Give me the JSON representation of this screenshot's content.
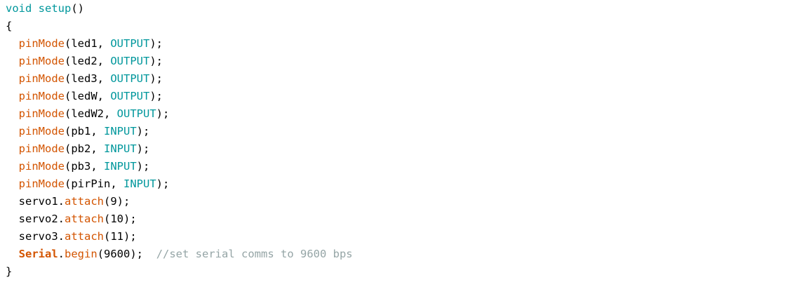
{
  "editor": {
    "lines": [
      [
        {
          "t": "void",
          "c": "kw"
        },
        {
          "t": " ",
          "c": ""
        },
        {
          "t": "setup",
          "c": "kw"
        },
        {
          "t": "()",
          "c": ""
        }
      ],
      [
        {
          "t": "{",
          "c": ""
        }
      ],
      [
        {
          "t": "  ",
          "c": ""
        },
        {
          "t": "pinMode",
          "c": "fn"
        },
        {
          "t": "(led1, ",
          "c": ""
        },
        {
          "t": "OUTPUT",
          "c": "const"
        },
        {
          "t": ");",
          "c": ""
        }
      ],
      [
        {
          "t": "  ",
          "c": ""
        },
        {
          "t": "pinMode",
          "c": "fn"
        },
        {
          "t": "(led2, ",
          "c": ""
        },
        {
          "t": "OUTPUT",
          "c": "const"
        },
        {
          "t": ");",
          "c": ""
        }
      ],
      [
        {
          "t": "  ",
          "c": ""
        },
        {
          "t": "pinMode",
          "c": "fn"
        },
        {
          "t": "(led3, ",
          "c": ""
        },
        {
          "t": "OUTPUT",
          "c": "const"
        },
        {
          "t": ");",
          "c": ""
        }
      ],
      [
        {
          "t": "  ",
          "c": ""
        },
        {
          "t": "pinMode",
          "c": "fn"
        },
        {
          "t": "(ledW, ",
          "c": ""
        },
        {
          "t": "OUTPUT",
          "c": "const"
        },
        {
          "t": ");",
          "c": ""
        }
      ],
      [
        {
          "t": "  ",
          "c": ""
        },
        {
          "t": "pinMode",
          "c": "fn"
        },
        {
          "t": "(ledW2, ",
          "c": ""
        },
        {
          "t": "OUTPUT",
          "c": "const"
        },
        {
          "t": ");",
          "c": ""
        }
      ],
      [
        {
          "t": "  ",
          "c": ""
        },
        {
          "t": "pinMode",
          "c": "fn"
        },
        {
          "t": "(pb1, ",
          "c": ""
        },
        {
          "t": "INPUT",
          "c": "const"
        },
        {
          "t": ");",
          "c": ""
        }
      ],
      [
        {
          "t": "  ",
          "c": ""
        },
        {
          "t": "pinMode",
          "c": "fn"
        },
        {
          "t": "(pb2, ",
          "c": ""
        },
        {
          "t": "INPUT",
          "c": "const"
        },
        {
          "t": ");",
          "c": ""
        }
      ],
      [
        {
          "t": "  ",
          "c": ""
        },
        {
          "t": "pinMode",
          "c": "fn"
        },
        {
          "t": "(pb3, ",
          "c": ""
        },
        {
          "t": "INPUT",
          "c": "const"
        },
        {
          "t": ");",
          "c": ""
        }
      ],
      [
        {
          "t": "  ",
          "c": ""
        },
        {
          "t": "pinMode",
          "c": "fn"
        },
        {
          "t": "(pirPin, ",
          "c": ""
        },
        {
          "t": "INPUT",
          "c": "const"
        },
        {
          "t": ");",
          "c": ""
        }
      ],
      [
        {
          "t": "  servo1.",
          "c": ""
        },
        {
          "t": "attach",
          "c": "fn"
        },
        {
          "t": "(9);",
          "c": ""
        }
      ],
      [
        {
          "t": "  servo2.",
          "c": ""
        },
        {
          "t": "attach",
          "c": "fn"
        },
        {
          "t": "(10);",
          "c": ""
        }
      ],
      [
        {
          "t": "  servo3.",
          "c": ""
        },
        {
          "t": "attach",
          "c": "fn"
        },
        {
          "t": "(11);",
          "c": ""
        }
      ],
      [
        {
          "t": "  ",
          "c": ""
        },
        {
          "t": "Serial",
          "c": "cls"
        },
        {
          "t": ".",
          "c": ""
        },
        {
          "t": "begin",
          "c": "fn"
        },
        {
          "t": "(9600);  ",
          "c": ""
        },
        {
          "t": "//set serial comms to 9600 bps",
          "c": "cmt"
        }
      ],
      [
        {
          "t": "}",
          "c": ""
        }
      ]
    ]
  }
}
